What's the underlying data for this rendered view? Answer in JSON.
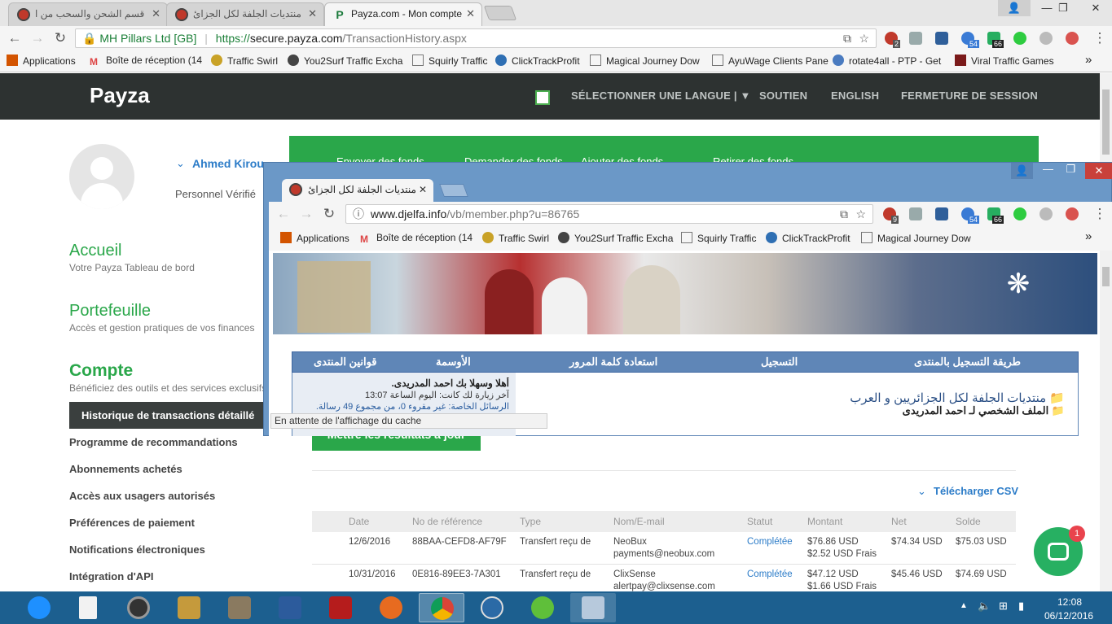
{
  "browser": {
    "tabs": [
      {
        "label": "قسم الشحن والسحب من ا"
      },
      {
        "label": "منتديات الجلفة لكل الجزائ"
      },
      {
        "label": "Payza.com - Mon compte"
      }
    ],
    "security_label": "MH Pillars Ltd [GB]",
    "url_scheme": "https://",
    "url_host": "secure.payza.com",
    "url_path": "/TransactionHistory.aspx",
    "extension_badges": [
      "2",
      "54",
      "66"
    ],
    "bookmarks": [
      {
        "label": "Applications",
        "icon": "apps-grid-icon"
      },
      {
        "label": "Boîte de réception (14",
        "icon": "gmail-icon"
      },
      {
        "label": "Traffic Swirl",
        "icon": "swirl-icon"
      },
      {
        "label": "You2Surf Traffic Excha",
        "icon": "globe-icon"
      },
      {
        "label": "Squirly Traffic",
        "icon": "page-icon"
      },
      {
        "label": "ClickTrackProfit",
        "icon": "ctp-icon"
      },
      {
        "label": "Magical Journey Dow",
        "icon": "page-icon"
      },
      {
        "label": "AyuWage Clients Pane",
        "icon": "page-icon"
      },
      {
        "label": "rotate4all - PTP - Get",
        "icon": "globe-icon"
      },
      {
        "label": "Viral Traffic Games",
        "icon": "vtg-icon"
      }
    ],
    "more_bookmarks": "»"
  },
  "payza": {
    "logo": "Payza",
    "nav": {
      "language": "SÉLECTIONNER UNE LANGUE | ▼",
      "support": "SOUTIEN",
      "english": "ENGLISH",
      "logout": "FERMETURE DE SESSION"
    },
    "actions": [
      "Envoyer des fonds",
      "Demander des fonds",
      "Ajouter des fonds",
      "Retirer des fonds"
    ],
    "user": {
      "name": "Ahmed Kirou",
      "verified": "Personnel Vérifié"
    },
    "sections": [
      {
        "title": "Accueil",
        "subtitle": "Votre Payza Tableau de bord"
      },
      {
        "title": "Portefeuille",
        "subtitle": "Accès et gestion pratiques de vos finances"
      },
      {
        "title": "Compte",
        "subtitle": "Bénéficiez des outils et des services exclusifs"
      }
    ],
    "menu_active": "Historique de transactions détaillé",
    "menu": [
      "Programme de recommandations",
      "Abonnements achetés",
      "Accès aux usagers autorisés",
      "Préférences de paiement",
      "Notifications électroniques",
      "Intégration d'API"
    ],
    "update_button": "Mettre les résultats à jour",
    "download_csv": "Télécharger CSV",
    "table": {
      "headers": [
        "Date",
        "No de référence",
        "Type",
        "Nom/E-mail",
        "Statut",
        "Montant",
        "Net",
        "Solde"
      ],
      "rows": [
        {
          "date": "12/6/2016",
          "ref": "88BAA-CEFD8-AF79F",
          "type": "Transfert reçu de",
          "name": "NeoBux",
          "email": "payments@neobux.com",
          "status": "Complétée",
          "amount": "$76.86 USD",
          "fee": "$2.52 USD Frais",
          "net": "$74.34 USD",
          "balance": "$75.03 USD"
        },
        {
          "date": "10/31/2016",
          "ref": "0E816-89EE3-7A301",
          "type": "Transfert reçu de",
          "name": "ClixSense",
          "email": "alertpay@clixsense.com",
          "status": "Complétée",
          "amount": "$47.12 USD",
          "fee": "$1.66 USD Frais",
          "net": "$45.46 USD",
          "balance": "$74.69 USD"
        }
      ]
    },
    "chat_badge": "1"
  },
  "popup": {
    "tab_label": "منتديات الجلفة لكل الجزائ",
    "url_host": "www.djelfa.info",
    "url_path": "/vb/member.php?u=86765",
    "extension_badges": [
      "9",
      "54",
      "66"
    ],
    "bookmarks": [
      {
        "label": "Applications"
      },
      {
        "label": "Boîte de réception (14"
      },
      {
        "label": "Traffic Swirl"
      },
      {
        "label": "You2Surf Traffic Excha"
      },
      {
        "label": "Squirly Traffic"
      },
      {
        "label": "ClickTrackProfit"
      },
      {
        "label": "Magical Journey Dow"
      }
    ],
    "nav": [
      "طريقة التسجيل بالمنتدى",
      "التسجيل",
      "استعادة كلمة المرور",
      "الأوسمة",
      "قوانين المنتدى"
    ],
    "welcome_title": "أهلا وسهلا بك احمد المدريدى.",
    "last_visit": "آخر زيارة لك كانت: اليوم الساعة 13:07",
    "private_msgs": "الرسائل الخاصة: غير مقروء 0، من مجموع 49 رسالة.",
    "forum_title": "منتديات الجلفة لكل الجزائريين و العرب",
    "profile_title": "الملف الشخصي لـ احمد المدريدى",
    "status_text": "En attente de l'affichage du cache"
  },
  "taskbar": {
    "time": "12:08",
    "date": "06/12/2016"
  }
}
